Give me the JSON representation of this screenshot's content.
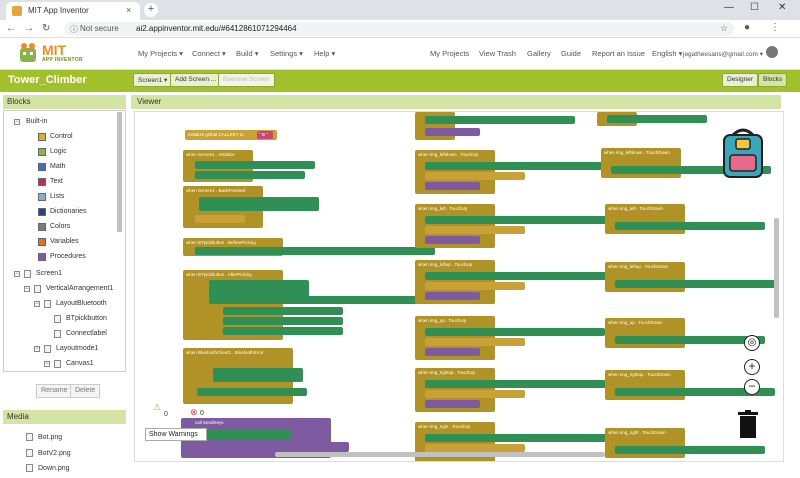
{
  "browser": {
    "tab_title": "MIT App Inventor",
    "tab_close": "×",
    "new_tab": "+",
    "not_secure": "Not secure",
    "url": "ai2.appinventor.mit.edu/#6412861071294464",
    "window_min": "—",
    "window_max": "☐",
    "window_close": "✕"
  },
  "header": {
    "logo_text": "MIT",
    "logo_sub": "APP INVENTOR",
    "menus": [
      "My Projects ▾",
      "Connect ▾",
      "Build ▾",
      "Settings ▾",
      "Help ▾"
    ],
    "right_links": [
      "My Projects",
      "View Trash",
      "Gallery",
      "Guide",
      "Report an Issue",
      "English ▾",
      "jegatheesans@gmail.com ▾"
    ]
  },
  "project": {
    "name": "Tower_Climber",
    "screen_button": "Screen1 ▾",
    "add_screen": "Add Screen ...",
    "remove_screen": "Remove Screen",
    "designer": "Designer",
    "blocks": "Blocks"
  },
  "blocks_panel": {
    "title": "Blocks",
    "builtin": {
      "label": "Built-in",
      "items": [
        {
          "label": "Control",
          "color": "#e1a93a"
        },
        {
          "label": "Logic",
          "color": "#8bb14b"
        },
        {
          "label": "Math",
          "color": "#3d72ba"
        },
        {
          "label": "Text",
          "color": "#b8314f"
        },
        {
          "label": "Lists",
          "color": "#84b0d8"
        },
        {
          "label": "Dictionaries",
          "color": "#2f3d8e"
        },
        {
          "label": "Colors",
          "color": "#7d7d7d"
        },
        {
          "label": "Variables",
          "color": "#e0712b"
        },
        {
          "label": "Procedures",
          "color": "#7e5aa0"
        }
      ]
    },
    "components": [
      "Screen1",
      "VerticalArrangement1",
      "LayoutBluetooth",
      "BTpickbutton",
      "Connectlabel",
      "Layoutmode1",
      "Canvas1"
    ],
    "rename": "Rename",
    "delete": "Delete"
  },
  "media": {
    "title": "Media",
    "files": [
      "Bot.png",
      "BotV2.png",
      "Down.png"
    ]
  },
  "viewer": {
    "title": "Viewer",
    "show_warnings": "Show Warnings",
    "warning_count": "0",
    "error_count": "0",
    "zoom_in": "+",
    "zoom_out": "−"
  },
  "workspace_blocks": [
    {
      "label": "initialize global CALLKEY to",
      "value": "\" B \""
    },
    {
      "label": "when Screen1 . Initialize"
    },
    {
      "label": "when Screen1 . BackPressed"
    },
    {
      "label": "when BTpickbutton . BeforePicking"
    },
    {
      "label": "when BTpickbutton . AfterPicking"
    },
    {
      "label": "when BluetoothClient1 . BluetoothError"
    },
    {
      "label": "when img_leftdown . TouchUp"
    },
    {
      "label": "when img_left . TouchUp"
    },
    {
      "label": "when img_leftup . TouchUp"
    },
    {
      "label": "when img_up . TouchUp"
    },
    {
      "label": "when img_rightup . TouchUp"
    },
    {
      "label": "when img_right . TouchUp"
    },
    {
      "label": "when img_leftdown . TouchDown"
    },
    {
      "label": "when img_left . TouchDown"
    },
    {
      "label": "when img_leftup . TouchDown"
    },
    {
      "label": "when img_up . TouchDown"
    },
    {
      "label": "when img_rightup . TouchDown"
    },
    {
      "label": "when img_right . TouchDown"
    },
    {
      "label": "call SendKeys"
    }
  ]
}
